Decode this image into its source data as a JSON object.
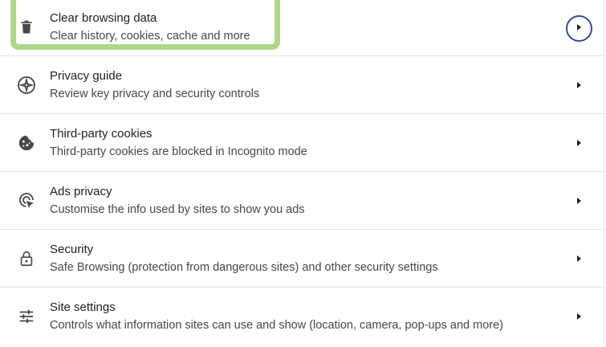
{
  "rows": [
    {
      "icon": "trash-icon",
      "title": "Clear browsing data",
      "subtitle": "Clear history, cookies, cache and more"
    },
    {
      "icon": "compass-icon",
      "title": "Privacy guide",
      "subtitle": "Review key privacy and security controls"
    },
    {
      "icon": "cookie-icon",
      "title": "Third-party cookies",
      "subtitle": "Third-party cookies are blocked in Incognito mode"
    },
    {
      "icon": "ads-privacy-icon",
      "title": "Ads privacy",
      "subtitle": "Customise the info used by sites to show you ads"
    },
    {
      "icon": "lock-icon",
      "title": "Security",
      "subtitle": "Safe Browsing (protection from dangerous sites) and other security settings"
    },
    {
      "icon": "sliders-icon",
      "title": "Site settings",
      "subtitle": "Controls what information sites can use and show (location, camera, pop-ups and more)"
    }
  ],
  "colors": {
    "annotation_highlight": "#a9d27c",
    "annotation_circle": "#2f4e93",
    "icon": "#474747",
    "divider": "#e3e3e3"
  }
}
